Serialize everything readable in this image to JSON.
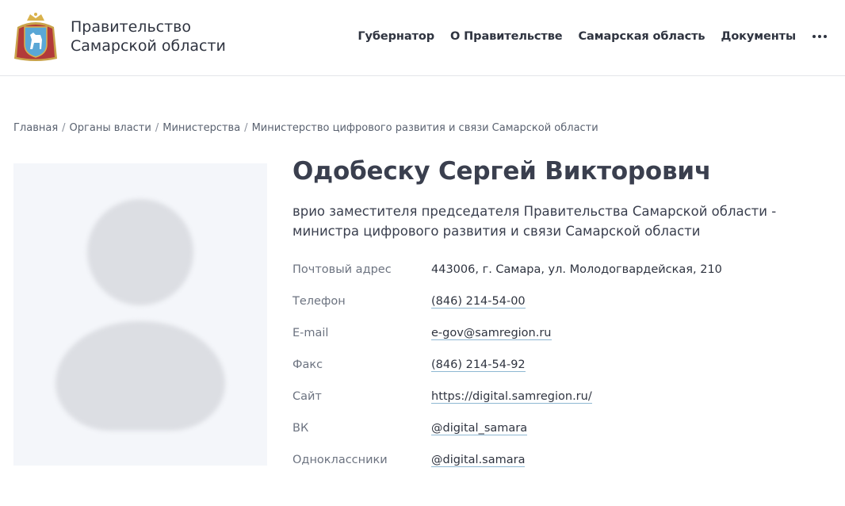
{
  "header": {
    "title_line1": "Правительство",
    "title_line2": "Самарской области",
    "nav": [
      "Губернатор",
      "О Правительстве",
      "Самарская область",
      "Документы"
    ]
  },
  "breadcrumb": [
    "Главная",
    "Органы власти",
    "Министерства",
    "Министерство цифрового развития и связи Самарской области"
  ],
  "profile": {
    "name": "Одобеску Сергей Викторович",
    "position": "врио заместителя председателя Правительства Самарской области - министра цифрового развития и связи Самарской области"
  },
  "contacts": [
    {
      "label": "Почтовый адрес",
      "value": "443006, г. Самара, ул. Молодогвардейская, 210"
    },
    {
      "label": "Телефон",
      "value": "(846) 214-54-00"
    },
    {
      "label": "E-mail",
      "value": "e-gov@samregion.ru"
    },
    {
      "label": "Факс",
      "value": "(846) 214-54-92"
    },
    {
      "label": "Сайт",
      "value": "https://digital.samregion.ru/"
    },
    {
      "label": "ВК",
      "value": "@digital_samara"
    },
    {
      "label": "Одноклассники",
      "value": "@digital.samara"
    }
  ],
  "icons": {
    "logo": "coat-of-arms-icon",
    "more": "more-dots-icon"
  }
}
